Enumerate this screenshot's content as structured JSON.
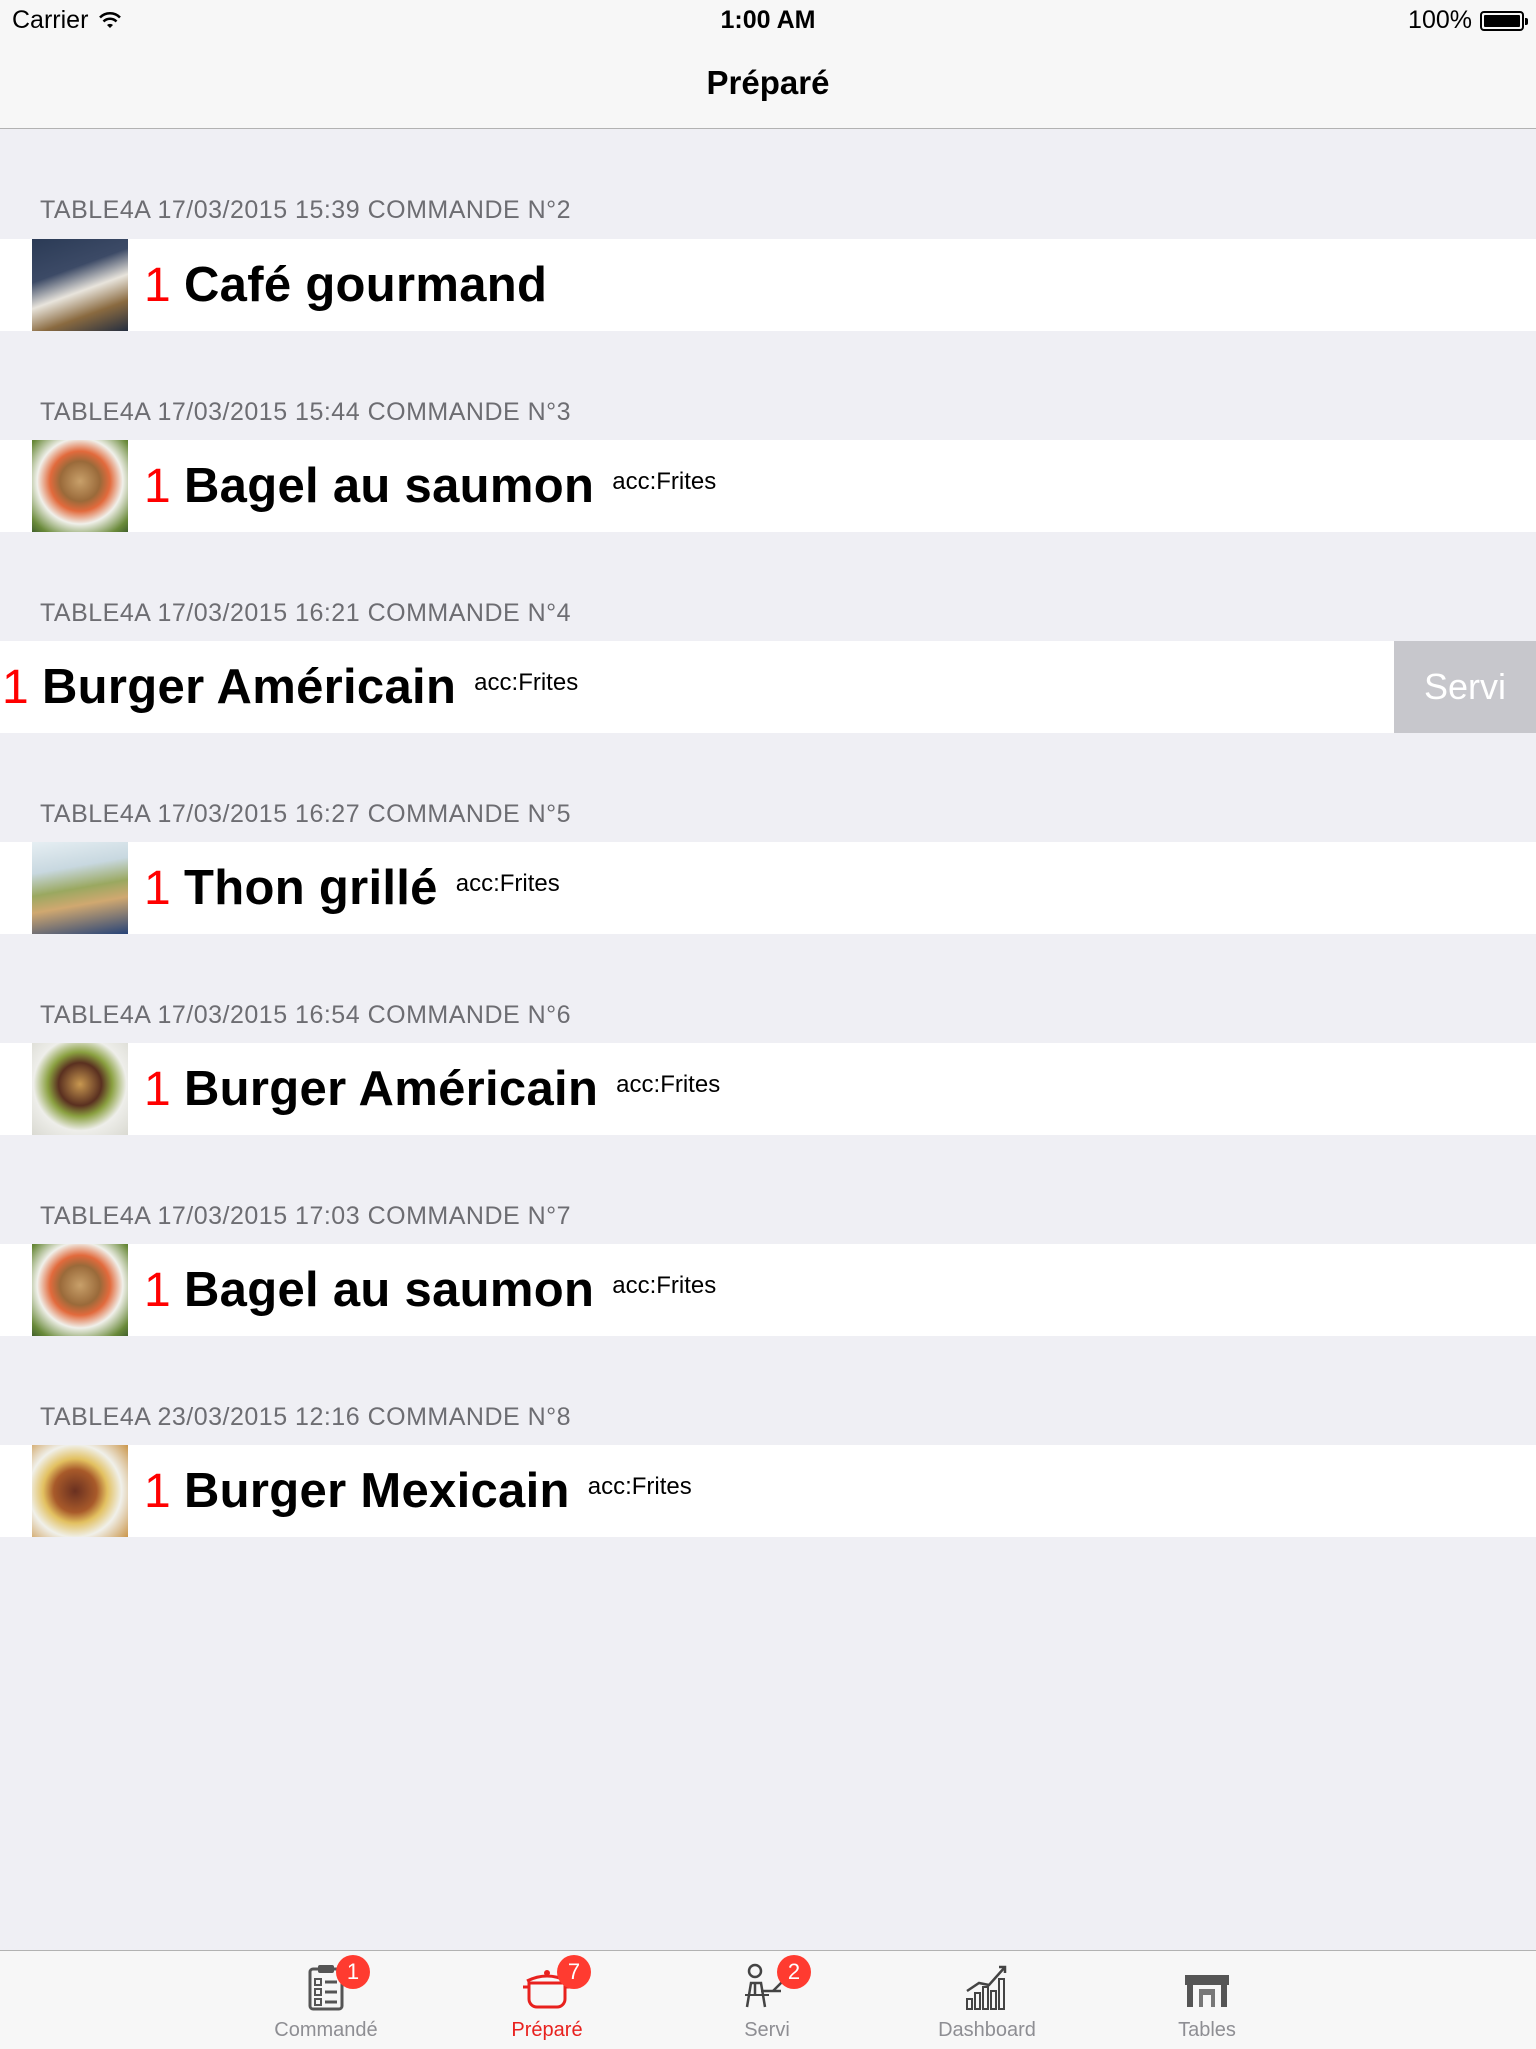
{
  "status_bar": {
    "carrier": "Carrier",
    "time": "1:00 AM",
    "battery": "100%"
  },
  "nav": {
    "title": "Préparé"
  },
  "orders": [
    {
      "header": "TABLE4A 17/03/2015 15:39 COMMANDE N°2",
      "qty": "1",
      "dish": "Café gourmand",
      "acc": "",
      "thumb": "cafe-gourmand-photo"
    },
    {
      "header": "TABLE4A 17/03/2015 15:44 COMMANDE N°3",
      "qty": "1",
      "dish": "Bagel au saumon",
      "acc": "acc:Frites",
      "thumb": "bagel-saumon-photo"
    },
    {
      "header": "TABLE4A 17/03/2015 16:21 COMMANDE N°4",
      "qty": "1",
      "dish": "Burger Américain",
      "acc": "acc:Frites",
      "thumb": "burger-americain-photo",
      "swipe_action": "Servi"
    },
    {
      "header": "TABLE4A 17/03/2015 16:27 COMMANDE N°5",
      "qty": "1",
      "dish": "Thon grillé",
      "acc": "acc:Frites",
      "thumb": "thon-grille-photo"
    },
    {
      "header": "TABLE4A 17/03/2015 16:54 COMMANDE N°6",
      "qty": "1",
      "dish": "Burger Américain",
      "acc": "acc:Frites",
      "thumb": "burger-americain-photo"
    },
    {
      "header": "TABLE4A 17/03/2015 17:03 COMMANDE N°7",
      "qty": "1",
      "dish": "Bagel au saumon",
      "acc": "acc:Frites",
      "thumb": "bagel-saumon-photo"
    },
    {
      "header": "TABLE4A 23/03/2015 12:16 COMMANDE N°8",
      "qty": "1",
      "dish": "Burger Mexicain",
      "acc": "acc:Frites",
      "thumb": "burger-mexicain-photo"
    }
  ],
  "tabs": [
    {
      "label": "Commandé",
      "badge": "1",
      "icon": "clipboard-icon",
      "active": false
    },
    {
      "label": "Préparé",
      "badge": "7",
      "icon": "cooking-pot-icon",
      "active": true
    },
    {
      "label": "Servi",
      "badge": "2",
      "icon": "waiter-icon",
      "active": false
    },
    {
      "label": "Dashboard",
      "badge": "",
      "icon": "bar-chart-icon",
      "active": false
    },
    {
      "label": "Tables",
      "badge": "",
      "icon": "table-icon",
      "active": false
    }
  ],
  "colors": {
    "accent": "#e8211e",
    "quantity": "#ff0000",
    "badge": "#ff3b30",
    "swipe_button": "#c7c7cc"
  }
}
